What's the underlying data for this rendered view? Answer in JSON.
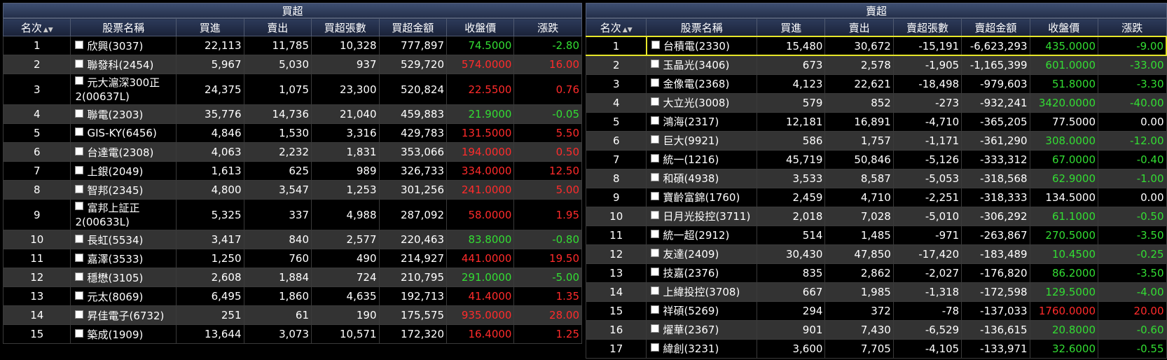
{
  "left": {
    "title": "買超",
    "columns": [
      "名次",
      "股票名稱",
      "買進",
      "賣出",
      "買超張數",
      "買超金額",
      "收盤價",
      "漲跌"
    ],
    "rows": [
      {
        "rank": "1",
        "name": "欣興(3037)",
        "buy": "22,113",
        "sell": "11,785",
        "qty": "10,328",
        "amount": "777,897",
        "close": "74.5000",
        "change": "-2.80",
        "dir": "down"
      },
      {
        "rank": "2",
        "name": "聯發科(2454)",
        "buy": "5,967",
        "sell": "5,030",
        "qty": "937",
        "amount": "529,720",
        "close": "574.0000",
        "change": "16.00",
        "dir": "up"
      },
      {
        "rank": "3",
        "name": "元大滬深300正2(00637L)",
        "buy": "24,375",
        "sell": "1,075",
        "qty": "23,300",
        "amount": "520,824",
        "close": "22.5500",
        "change": "0.76",
        "dir": "up",
        "tall": true
      },
      {
        "rank": "4",
        "name": "聯電(2303)",
        "buy": "35,776",
        "sell": "14,736",
        "qty": "21,040",
        "amount": "459,883",
        "close": "21.9000",
        "change": "-0.05",
        "dir": "down"
      },
      {
        "rank": "5",
        "name": "GIS-KY(6456)",
        "buy": "4,846",
        "sell": "1,530",
        "qty": "3,316",
        "amount": "429,783",
        "close": "131.5000",
        "change": "5.50",
        "dir": "up"
      },
      {
        "rank": "6",
        "name": "台達電(2308)",
        "buy": "4,063",
        "sell": "2,232",
        "qty": "1,831",
        "amount": "353,066",
        "close": "194.0000",
        "change": "0.50",
        "dir": "up"
      },
      {
        "rank": "7",
        "name": "上銀(2049)",
        "buy": "1,613",
        "sell": "625",
        "qty": "989",
        "amount": "326,733",
        "close": "334.0000",
        "change": "12.50",
        "dir": "up"
      },
      {
        "rank": "8",
        "name": "智邦(2345)",
        "buy": "4,800",
        "sell": "3,547",
        "qty": "1,253",
        "amount": "301,256",
        "close": "241.0000",
        "change": "5.00",
        "dir": "up"
      },
      {
        "rank": "9",
        "name": "富邦上証正2(00633L)",
        "buy": "5,325",
        "sell": "337",
        "qty": "4,988",
        "amount": "287,092",
        "close": "58.0000",
        "change": "1.95",
        "dir": "up",
        "tall": true
      },
      {
        "rank": "10",
        "name": "長虹(5534)",
        "buy": "3,417",
        "sell": "840",
        "qty": "2,577",
        "amount": "220,463",
        "close": "83.8000",
        "change": "-0.80",
        "dir": "down"
      },
      {
        "rank": "11",
        "name": "嘉澤(3533)",
        "buy": "1,250",
        "sell": "760",
        "qty": "490",
        "amount": "214,927",
        "close": "441.0000",
        "change": "19.50",
        "dir": "up"
      },
      {
        "rank": "12",
        "name": "穩懋(3105)",
        "buy": "2,608",
        "sell": "1,884",
        "qty": "724",
        "amount": "210,795",
        "close": "291.0000",
        "change": "-5.00",
        "dir": "down"
      },
      {
        "rank": "13",
        "name": "元太(8069)",
        "buy": "6,495",
        "sell": "1,860",
        "qty": "4,635",
        "amount": "192,713",
        "close": "41.4000",
        "change": "1.35",
        "dir": "up"
      },
      {
        "rank": "14",
        "name": "昇佳電子(6732)",
        "buy": "251",
        "sell": "61",
        "qty": "190",
        "amount": "175,575",
        "close": "935.0000",
        "change": "28.00",
        "dir": "up"
      },
      {
        "rank": "15",
        "name": "築成(1909)",
        "buy": "13,644",
        "sell": "3,073",
        "qty": "10,571",
        "amount": "172,320",
        "close": "16.4000",
        "change": "1.25",
        "dir": "up"
      }
    ]
  },
  "right": {
    "title": "賣超",
    "columns": [
      "名次",
      "股票名稱",
      "買進",
      "賣出",
      "賣超張數",
      "賣超金額",
      "收盤價",
      "漲跌"
    ],
    "rows": [
      {
        "rank": "1",
        "name": "台積電(2330)",
        "buy": "15,480",
        "sell": "30,672",
        "qty": "-15,191",
        "amount": "-6,623,293",
        "close": "435.0000",
        "change": "-9.00",
        "dir": "down",
        "selected": true
      },
      {
        "rank": "2",
        "name": "玉晶光(3406)",
        "buy": "673",
        "sell": "2,578",
        "qty": "-1,905",
        "amount": "-1,165,399",
        "close": "601.0000",
        "change": "-33.00",
        "dir": "down"
      },
      {
        "rank": "3",
        "name": "金像電(2368)",
        "buy": "4,123",
        "sell": "22,621",
        "qty": "-18,498",
        "amount": "-979,603",
        "close": "51.8000",
        "change": "-3.30",
        "dir": "down"
      },
      {
        "rank": "4",
        "name": "大立光(3008)",
        "buy": "579",
        "sell": "852",
        "qty": "-273",
        "amount": "-932,241",
        "close": "3420.0000",
        "change": "-40.00",
        "dir": "down"
      },
      {
        "rank": "5",
        "name": "鴻海(2317)",
        "buy": "12,181",
        "sell": "16,891",
        "qty": "-4,710",
        "amount": "-365,205",
        "close": "77.5000",
        "change": "0.00",
        "dir": "flat"
      },
      {
        "rank": "6",
        "name": "巨大(9921)",
        "buy": "586",
        "sell": "1,757",
        "qty": "-1,171",
        "amount": "-361,290",
        "close": "308.0000",
        "change": "-12.00",
        "dir": "down"
      },
      {
        "rank": "7",
        "name": "統一(1216)",
        "buy": "45,719",
        "sell": "50,846",
        "qty": "-5,126",
        "amount": "-333,312",
        "close": "67.0000",
        "change": "-0.40",
        "dir": "down"
      },
      {
        "rank": "8",
        "name": "和碩(4938)",
        "buy": "3,533",
        "sell": "8,587",
        "qty": "-5,053",
        "amount": "-318,568",
        "close": "62.9000",
        "change": "-1.00",
        "dir": "down"
      },
      {
        "rank": "9",
        "name": "寶齡富錦(1760)",
        "buy": "2,459",
        "sell": "4,710",
        "qty": "-2,251",
        "amount": "-318,333",
        "close": "134.5000",
        "change": "0.00",
        "dir": "flat"
      },
      {
        "rank": "10",
        "name": "日月光投控(3711)",
        "buy": "2,018",
        "sell": "7,028",
        "qty": "-5,010",
        "amount": "-306,292",
        "close": "61.1000",
        "change": "-0.50",
        "dir": "down"
      },
      {
        "rank": "11",
        "name": "統一超(2912)",
        "buy": "514",
        "sell": "1,485",
        "qty": "-971",
        "amount": "-263,867",
        "close": "270.5000",
        "change": "-3.50",
        "dir": "down"
      },
      {
        "rank": "12",
        "name": "友達(2409)",
        "buy": "30,430",
        "sell": "47,850",
        "qty": "-17,420",
        "amount": "-183,489",
        "close": "10.4500",
        "change": "-0.25",
        "dir": "down"
      },
      {
        "rank": "13",
        "name": "技嘉(2376)",
        "buy": "835",
        "sell": "2,862",
        "qty": "-2,027",
        "amount": "-176,820",
        "close": "86.2000",
        "change": "-3.50",
        "dir": "down"
      },
      {
        "rank": "14",
        "name": "上緯投控(3708)",
        "buy": "667",
        "sell": "1,985",
        "qty": "-1,318",
        "amount": "-172,598",
        "close": "129.5000",
        "change": "-4.00",
        "dir": "down"
      },
      {
        "rank": "15",
        "name": "祥碩(5269)",
        "buy": "294",
        "sell": "372",
        "qty": "-78",
        "amount": "-137,033",
        "close": "1760.0000",
        "change": "20.00",
        "dir": "up"
      },
      {
        "rank": "16",
        "name": "燿華(2367)",
        "buy": "901",
        "sell": "7,430",
        "qty": "-6,529",
        "amount": "-136,615",
        "close": "20.8000",
        "change": "-0.60",
        "dir": "down"
      },
      {
        "rank": "17",
        "name": "緯創(3231)",
        "buy": "3,600",
        "sell": "7,705",
        "qty": "-4,105",
        "amount": "-133,971",
        "close": "32.6000",
        "change": "-0.55",
        "dir": "down"
      }
    ]
  },
  "icons": {
    "sort": "sort-arrows-icon",
    "checkbox": "checkbox-icon"
  },
  "colors": {
    "up": "#ff2b2b",
    "down": "#33dd33",
    "flat": "#ffffff",
    "selection": "#e6e62a",
    "header_bg": "#25304a"
  }
}
